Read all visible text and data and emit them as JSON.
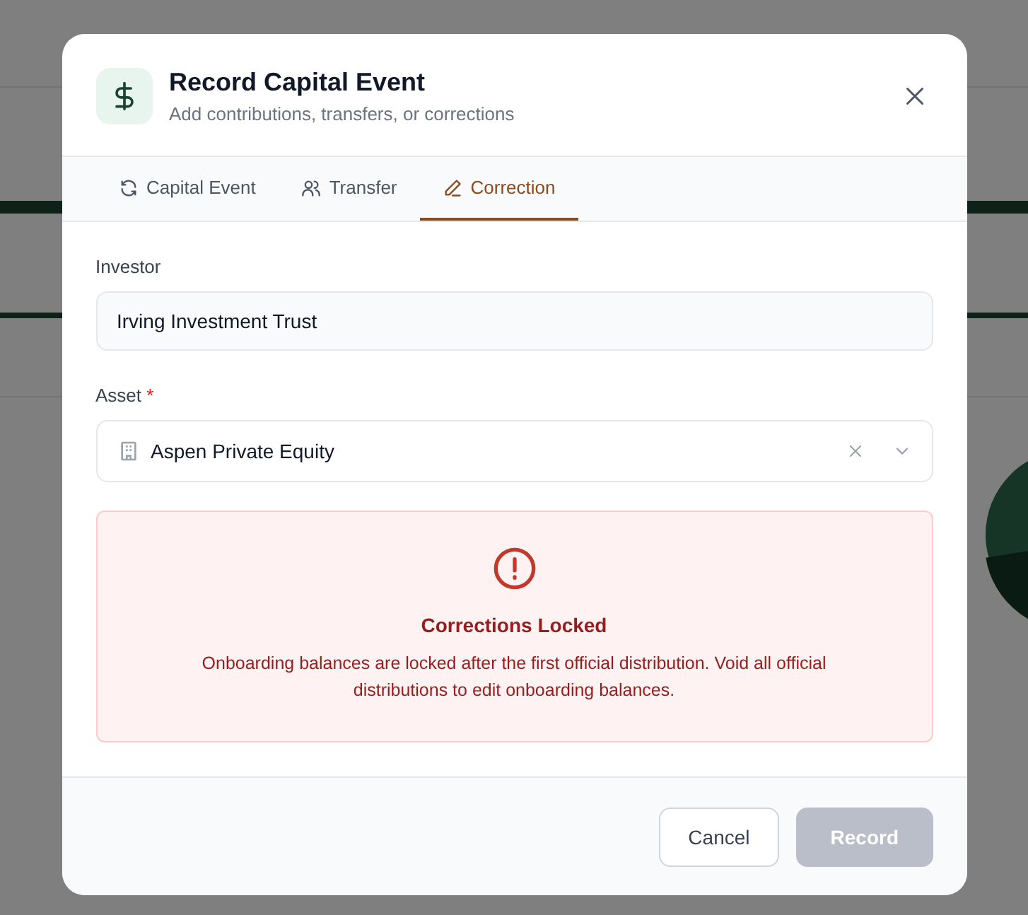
{
  "dialog": {
    "title": "Record Capital Event",
    "subtitle": "Add contributions, transfers, or corrections",
    "tabs": [
      {
        "label": "Capital Event",
        "selected": false
      },
      {
        "label": "Transfer",
        "selected": false
      },
      {
        "label": "Correction",
        "selected": true
      }
    ],
    "investor": {
      "label": "Investor",
      "value": "Irving Investment Trust"
    },
    "asset": {
      "label": "Asset",
      "required_mark": "*",
      "value": "Aspen Private Equity"
    },
    "alert": {
      "title": "Corrections Locked",
      "message": "Onboarding balances are locked after the first official distribution. Void all official distributions to edit onboarding balances."
    },
    "buttons": [
      {
        "label": "Cancel",
        "kind": "secondary"
      },
      {
        "label": "Record",
        "kind": "primary",
        "disabled": true
      }
    ]
  }
}
